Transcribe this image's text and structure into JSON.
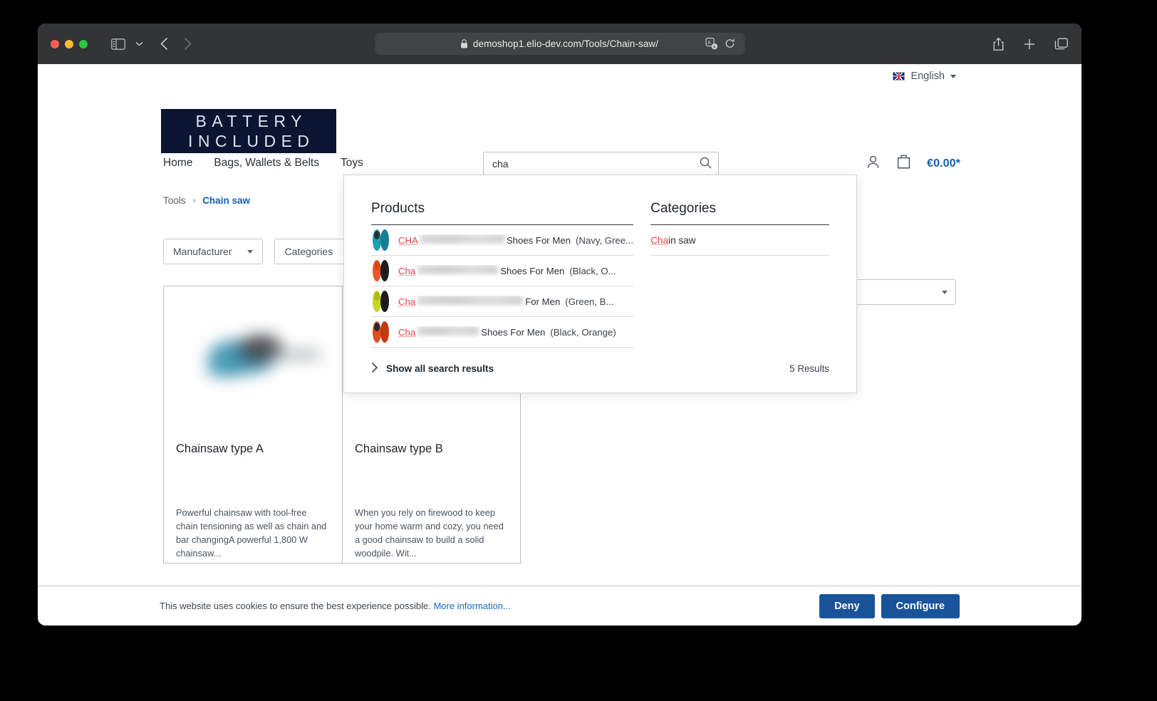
{
  "browser": {
    "url": "demoshop1.elio-dev.com/Tools/Chain-saw/",
    "icons": {
      "lock": "lock-icon",
      "sidebar": "sidebar-toggle-icon",
      "back": "back-arrow-icon",
      "forward": "forward-arrow-icon",
      "translate": "translate-icon",
      "reload": "reload-icon",
      "share": "share-icon",
      "new_tab": "plus-icon",
      "tab_overview": "tab-overview-icon"
    }
  },
  "util": {
    "language": "English",
    "flag": "uk-flag-icon"
  },
  "header": {
    "logo_line1": "BATTERY",
    "logo_line2": "INCLUDED",
    "cart_total": "€0.00*",
    "account_icon": "user-icon",
    "cart_icon": "bag-icon"
  },
  "search": {
    "value": "cha",
    "placeholder": "",
    "submit_icon": "search-icon"
  },
  "nav": {
    "items": [
      {
        "label": "Home"
      },
      {
        "label": "Bags, Wallets & Belts"
      },
      {
        "label": "Toys"
      }
    ]
  },
  "breadcrumb": {
    "parent": "Tools",
    "separator": "›",
    "current": "Chain saw"
  },
  "filters": {
    "manufacturer": "Manufacturer",
    "categories": "Categories"
  },
  "dropdown": {
    "products_heading": "Products",
    "categories_heading": "Categories",
    "products": [
      {
        "highlight": "CHA",
        "redacted_width": 118,
        "suffix": "Shoes For Men",
        "variant": "(Navy, Gree...",
        "thumb_colors": [
          "#1f9fae",
          "#14808f",
          "#2a2f36"
        ]
      },
      {
        "highlight": "Cha",
        "redacted_width": 113,
        "suffix": "Shoes For Men",
        "variant": "(Black, O...",
        "thumb_colors": [
          "#e8582a",
          "#1d1d20",
          "#d9480f"
        ]
      },
      {
        "highlight": "Cha",
        "redacted_width": 148,
        "suffix": "For Men",
        "variant": "(Green, B...",
        "thumb_colors": [
          "#c8d723",
          "#1d1d20",
          "#a8bc12"
        ]
      },
      {
        "highlight": "Cha",
        "redacted_width": 86,
        "suffix": "Shoes For Men",
        "variant": "(Black, Orange)",
        "thumb_colors": [
          "#e04e1f",
          "#c23a12",
          "#2a2a2c"
        ]
      }
    ],
    "categories": [
      {
        "highlight": "Cha",
        "rest": "in saw"
      }
    ],
    "show_all": "Show all search results",
    "show_all_icon": "chevron-right-icon",
    "results_count": "5 Results"
  },
  "products": [
    {
      "title": "Chainsaw type A",
      "description": "Powerful chainsaw with tool-free chain tensioning as well as chain and bar changingA powerful 1,800 W chainsaw...",
      "image_colors": [
        "#2f89a8",
        "#3b4046",
        "#8f9499"
      ]
    },
    {
      "title": "Chainsaw type B",
      "description": "When you rely on firewood to keep your home warm and cozy, you need a good chainsaw to build a solid woodpile. Wit...",
      "image_colors": [
        "#f08a1e",
        "#4a4e53",
        "#a9aeb3"
      ]
    }
  ],
  "cookie": {
    "text": "This website uses cookies to ensure the best experience possible.",
    "link": "More information...",
    "deny": "Deny",
    "configure": "Configure"
  },
  "colors": {
    "accent_blue": "#1160b4",
    "button_blue": "#19539a",
    "logo_navy": "#0b1532",
    "highlight_red": "#e8414c"
  }
}
